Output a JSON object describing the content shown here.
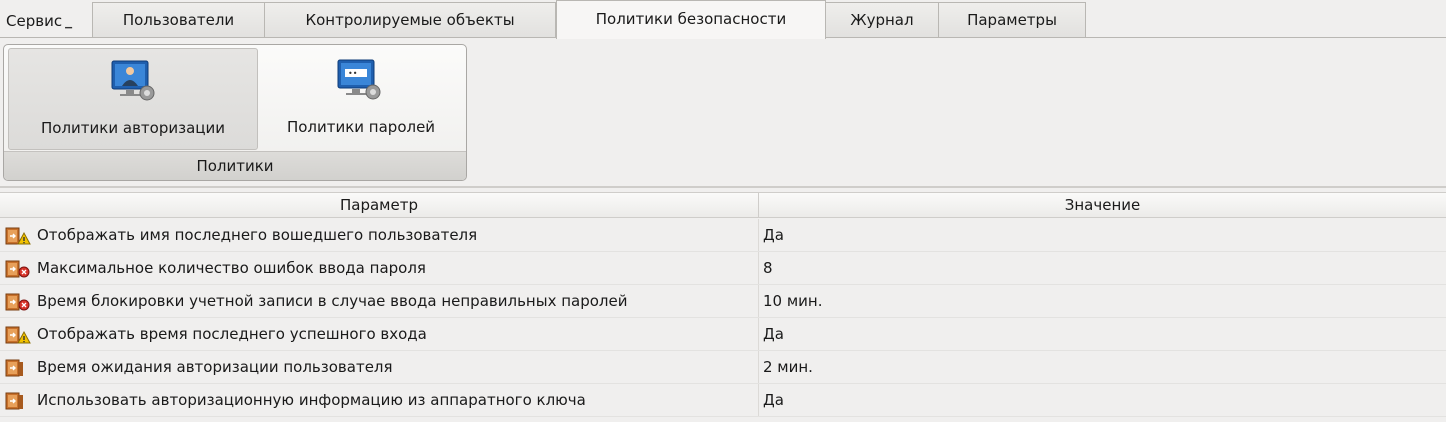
{
  "menu": {
    "service_label": "Сервис"
  },
  "tabs": [
    {
      "label": "Пользователи"
    },
    {
      "label": "Контролируемые объекты"
    },
    {
      "label": "Политики безопасности"
    },
    {
      "label": "Журнал"
    },
    {
      "label": "Параметры"
    }
  ],
  "active_tab": "Политики безопасности",
  "ribbon": {
    "buttons": [
      {
        "label": "Политики авторизации",
        "icon": "user-monitor-gear-icon",
        "pressed": true
      },
      {
        "label": "Политики паролей",
        "icon": "password-monitor-gear-icon",
        "pressed": false
      }
    ],
    "group_label": "Политики"
  },
  "table": {
    "headers": {
      "param": "Параметр",
      "value": "Значение"
    },
    "rows": [
      {
        "param": "Отображать имя последнего вошедшего пользователя",
        "value": "Да",
        "icon": "door-warning-icon"
      },
      {
        "param": "Максимальное количество ошибок ввода пароля",
        "value": "8",
        "icon": "door-error-icon"
      },
      {
        "param": "Время блокировки учетной записи в случае ввода неправильных паролей",
        "value": "10 мин.",
        "icon": "door-error-icon"
      },
      {
        "param": "Отображать время последнего успешного входа",
        "value": "Да",
        "icon": "door-warning-icon"
      },
      {
        "param": "Время ожидания авторизации пользователя",
        "value": "2 мин.",
        "icon": "door-icon"
      },
      {
        "param": "Использовать авторизационную информацию из аппаратного ключа",
        "value": "Да",
        "icon": "door-icon"
      }
    ]
  },
  "colors": {
    "warning": "#f2c200",
    "error": "#d8342a",
    "door": "#c8702a"
  }
}
